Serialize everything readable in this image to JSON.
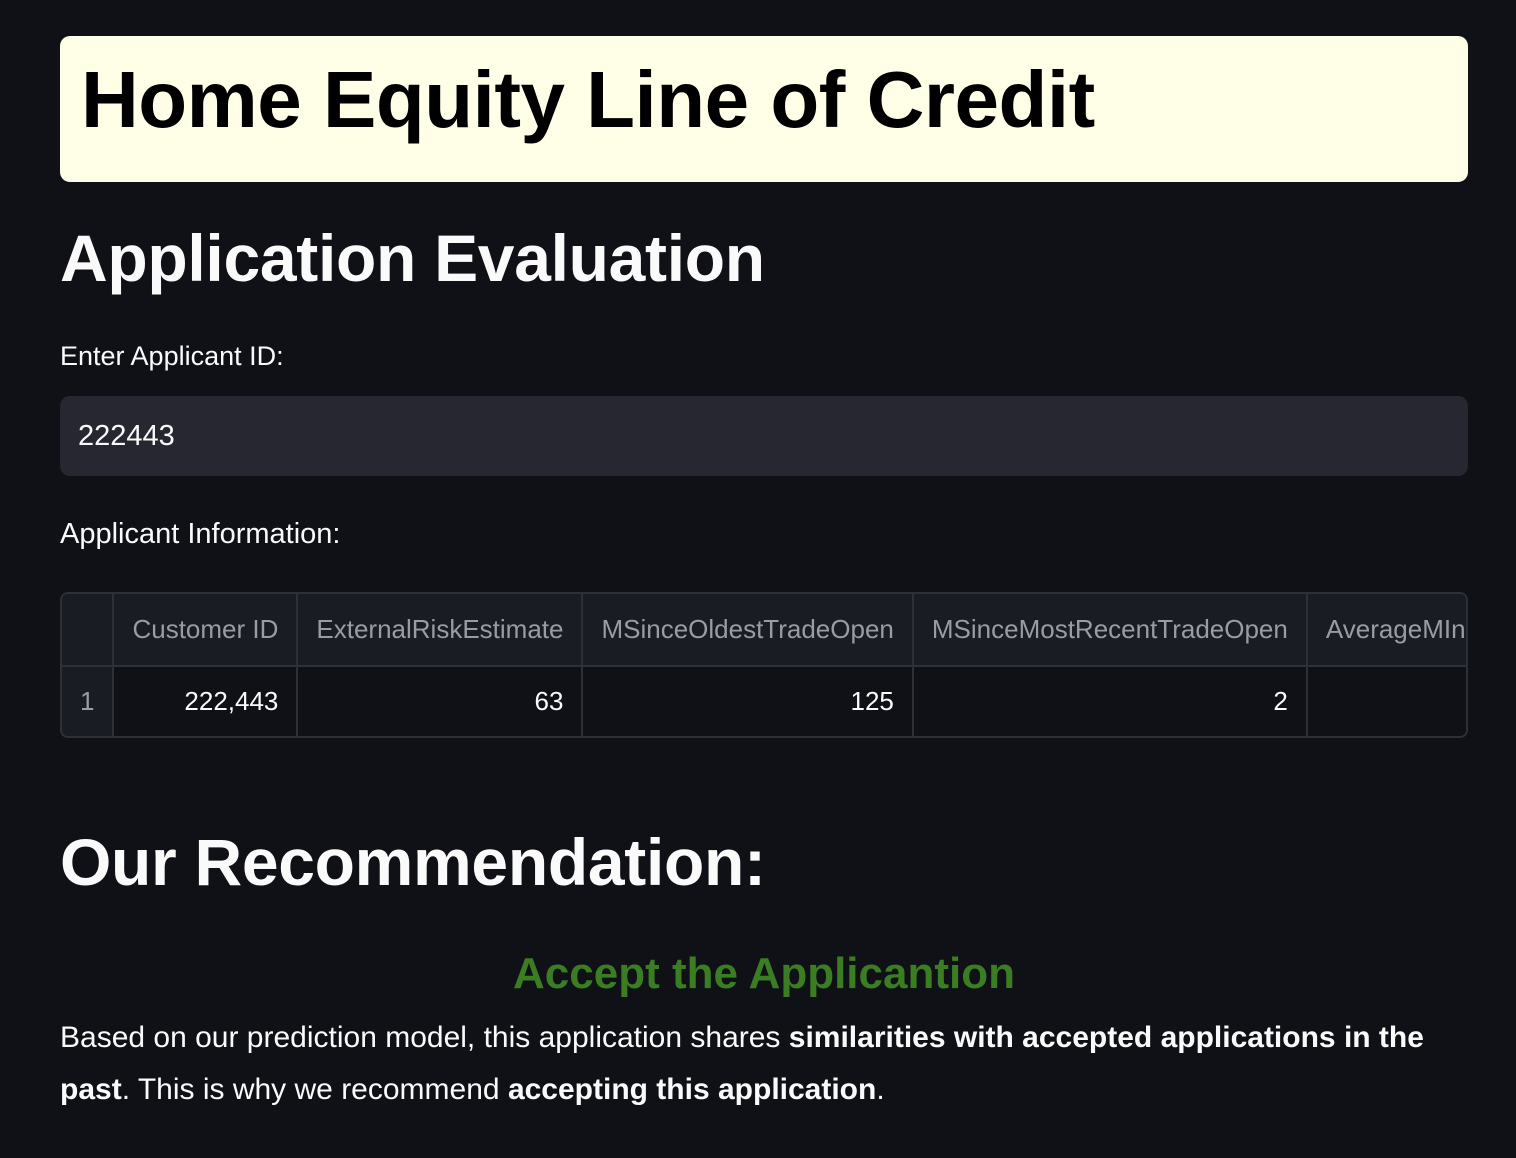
{
  "banner": {
    "title": "Home Equity Line of Credit",
    "background": "#fffee6"
  },
  "evaluation": {
    "heading": "Application Evaluation",
    "id_label": "Enter Applicant ID:",
    "id_value": "222443",
    "info_label": "Applicant Information:"
  },
  "table": {
    "columns": [
      "",
      "Customer ID",
      "ExternalRiskEstimate",
      "MSinceOldestTradeOpen",
      "MSinceMostRecentTradeOpen",
      "AverageMInFile"
    ],
    "rows": [
      [
        "1",
        "222,443",
        "63",
        "125",
        "2",
        ""
      ]
    ]
  },
  "recommendation": {
    "heading": "Our Recommendation:",
    "verdict": "Accept the Applicantion",
    "verdict_color": "#3a7d22",
    "text_1": "Based on our prediction model, this application shares ",
    "text_bold_1": "similarities with accepted applications in the past",
    "text_2": ". This is why we recommend ",
    "text_bold_2": "accepting this application",
    "text_3": "."
  }
}
